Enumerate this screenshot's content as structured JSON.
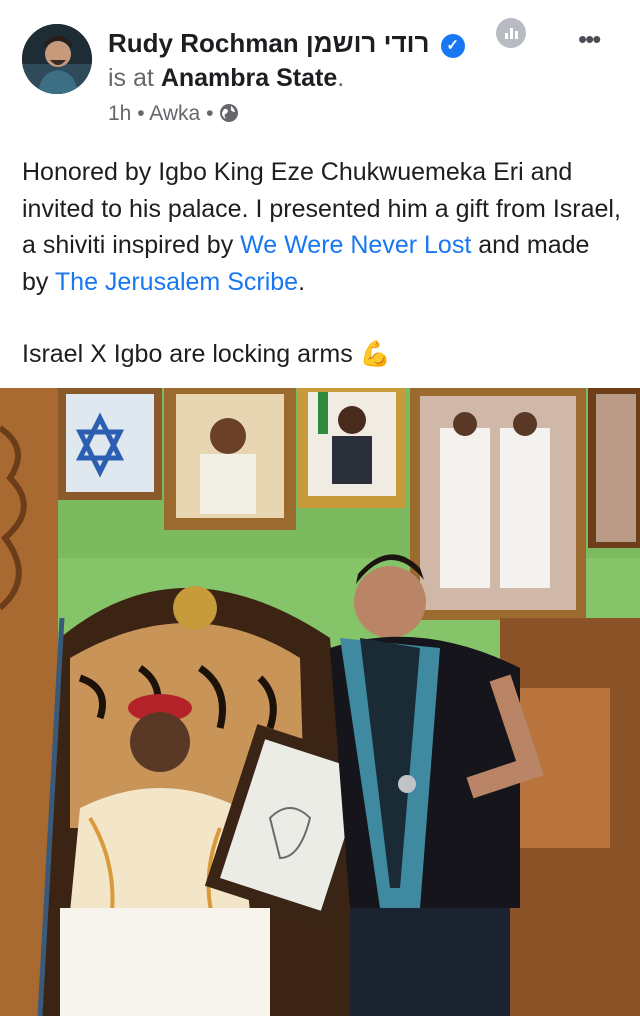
{
  "author": {
    "name": "Rudy Rochman",
    "name_hebrew": "רודי רושמן",
    "verified": true
  },
  "checkin": {
    "prefix": "is at",
    "place": "Anambra State",
    "suffix": "."
  },
  "meta": {
    "time": "1h",
    "separator": "•",
    "location": "Awka",
    "audience_icon": "globe-icon"
  },
  "post": {
    "line1_before": "Honored by Igbo King Eze Chukwuemeka Eri and invited to his palace. I presented him a gift from Israel, a shiviti inspired by ",
    "link1": "We Were Never Lost",
    "between": " and made by ",
    "link2": "The Jerusalem Scribe",
    "line1_end": ".",
    "line2": "Israel X Igbo are locking arms",
    "emoji": "💪"
  },
  "colors": {
    "link": "#1877f2",
    "verified": "#1877f2",
    "muted": "#65676b",
    "wall": "#86c46a"
  },
  "photo": {
    "description_icons": [
      "framed-portraits",
      "tiger-throne",
      "shiviti-frame"
    ]
  }
}
